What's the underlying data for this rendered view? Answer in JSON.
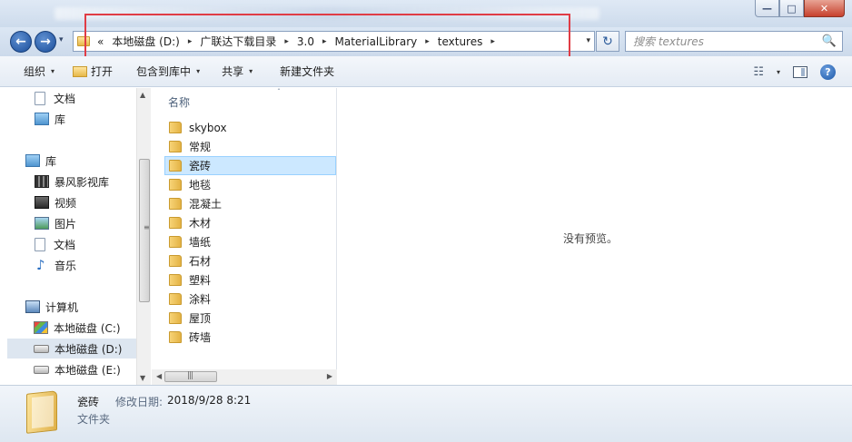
{
  "window": {
    "controls": {
      "minimize": "—",
      "maximize": "□",
      "close": "✕"
    }
  },
  "nav": {
    "back_icon": "arrow-left-icon",
    "forward_icon": "arrow-right-icon",
    "dropdown": "▾"
  },
  "address": {
    "overflow": "«",
    "crumbs": [
      "本地磁盘 (D:)",
      "广联达下载目录",
      "3.0",
      "MaterialLibrary",
      "textures"
    ],
    "separator": "▸",
    "dropdown": "▾",
    "refresh": "↻"
  },
  "search": {
    "placeholder": "搜索 textures",
    "icon": "🔍"
  },
  "toolbar": {
    "organize": "组织",
    "open": "打开",
    "include_in_library": "包含到库中",
    "share": "共享",
    "new_folder": "新建文件夹",
    "caret": "▾",
    "view_icon": "☷",
    "help": "?"
  },
  "navpane": {
    "items": [
      {
        "label": "文档",
        "icon": "document-icon"
      },
      {
        "label": "库",
        "icon": "library-icon"
      },
      {
        "label": "库",
        "icon": "library-icon"
      },
      {
        "label": "暴风影视库",
        "icon": "film-library-icon"
      },
      {
        "label": "视频",
        "icon": "video-icon"
      },
      {
        "label": "图片",
        "icon": "pictures-icon"
      },
      {
        "label": "文档",
        "icon": "document-icon"
      },
      {
        "label": "音乐",
        "icon": "music-icon"
      },
      {
        "label": "计算机",
        "icon": "computer-icon"
      },
      {
        "label": "本地磁盘 (C:)",
        "icon": "drive-c-icon"
      },
      {
        "label": "本地磁盘 (D:)",
        "icon": "drive-icon"
      },
      {
        "label": "本地磁盘 (E:)",
        "icon": "drive-icon"
      }
    ]
  },
  "filelist": {
    "column_name": "名称",
    "sort_indicator": "ˆ",
    "folders": [
      "skybox",
      "常规",
      "瓷砖",
      "地毯",
      "混凝土",
      "木材",
      "墙纸",
      "石材",
      "塑料",
      "涂料",
      "屋顶",
      "砖墙"
    ],
    "selected": "瓷砖"
  },
  "preview": {
    "message": "没有预览。"
  },
  "status": {
    "name": "瓷砖",
    "modified_label": "修改日期:",
    "modified_value": "2018/9/28 8:21",
    "type": "文件夹"
  },
  "colors": {
    "highlight_border": "#e03c45",
    "selection": "#cce8ff"
  }
}
